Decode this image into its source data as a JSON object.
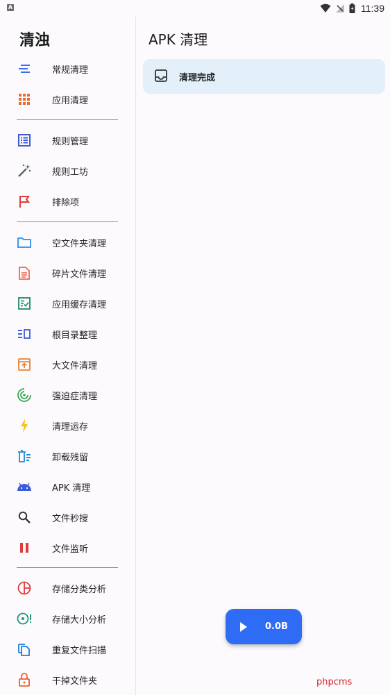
{
  "status_bar": {
    "time": "11:39",
    "notification_icon": "A"
  },
  "drawer": {
    "app_title": "清浊",
    "groups": [
      {
        "items": [
          {
            "label": "常规清理",
            "icon": "lines-icon"
          },
          {
            "label": "应用清理",
            "icon": "grid-icon"
          }
        ]
      },
      {
        "items": [
          {
            "label": "规则管理",
            "icon": "list-icon"
          },
          {
            "label": "规则工坊",
            "icon": "magic-wand-icon"
          },
          {
            "label": "排除项",
            "icon": "flag-icon"
          }
        ]
      },
      {
        "items": [
          {
            "label": "空文件夹清理",
            "icon": "folder-icon"
          },
          {
            "label": "碎片文件清理",
            "icon": "document-icon"
          },
          {
            "label": "应用缓存清理",
            "icon": "checklist-icon"
          },
          {
            "label": "根目录整理",
            "icon": "view-list-icon"
          },
          {
            "label": "大文件清理",
            "icon": "archive-upload-icon"
          },
          {
            "label": "强迫症清理",
            "icon": "target-icon"
          },
          {
            "label": "清理运存",
            "icon": "flash-icon"
          },
          {
            "label": "卸载残留",
            "icon": "uninstall-icon"
          },
          {
            "label": "APK 清理",
            "icon": "android-icon"
          },
          {
            "label": "文件秒搜",
            "icon": "search-icon"
          },
          {
            "label": "文件监听",
            "icon": "pause-icon"
          }
        ]
      },
      {
        "items": [
          {
            "label": "存储分类分析",
            "icon": "pie-chart-icon"
          },
          {
            "label": "存储大小分析",
            "icon": "storage-size-icon"
          },
          {
            "label": "重复文件扫描",
            "icon": "copy-icon"
          },
          {
            "label": "干掉文件夹",
            "icon": "lock-icon"
          }
        ]
      }
    ]
  },
  "main": {
    "title": "APK 清理",
    "result": {
      "label": "清理完成",
      "icon": "inbox-icon"
    },
    "fab": {
      "label": "0.0B",
      "icon": "play-icon"
    }
  },
  "watermark": "phpcms",
  "colors": {
    "accent": "#2f6cf6",
    "card": "#e3f0fa",
    "background": "#fcfafd",
    "watermark": "#d8262c"
  }
}
